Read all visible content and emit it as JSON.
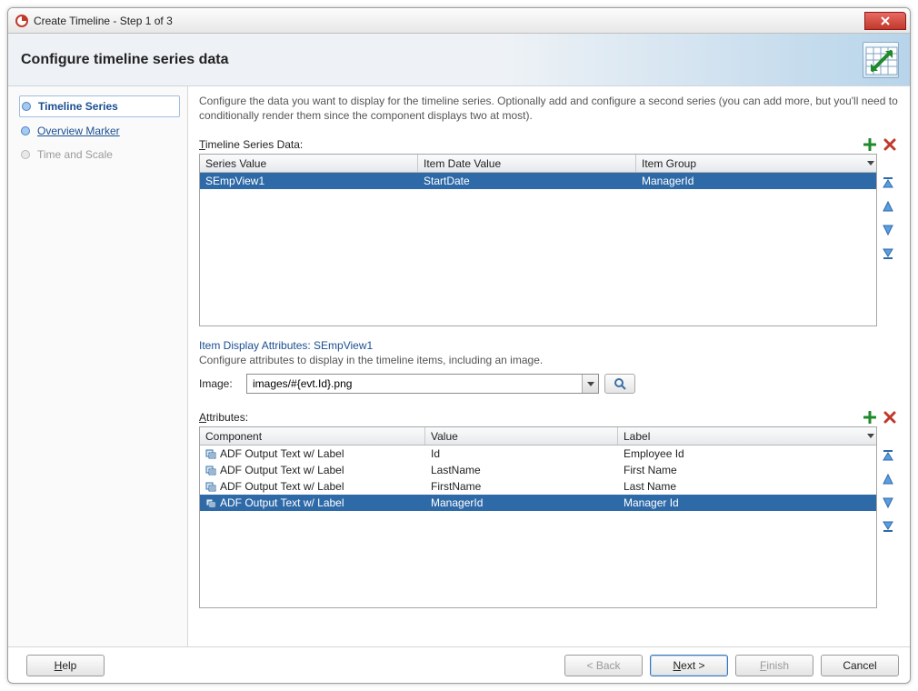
{
  "window": {
    "title": "Create Timeline - Step 1 of 3"
  },
  "header": {
    "title": "Configure timeline series data"
  },
  "description": "Configure the data you want to display for the timeline series. Optionally add and configure a second series (you can add more, but you'll need to conditionally render them since the component displays two at most).",
  "nav": {
    "items": [
      {
        "label": "Timeline Series",
        "state": "active"
      },
      {
        "label": "Overview Marker",
        "state": "link"
      },
      {
        "label": "Time and Scale",
        "state": "disabled"
      }
    ]
  },
  "series": {
    "label_pre": "T",
    "label_rest": "imeline Series Data:",
    "columns": {
      "c1": "Series Value",
      "c2": "Item Date Value",
      "c3": "Item Group"
    },
    "rows": [
      {
        "c1": "SEmpView1",
        "c2": "StartDate",
        "c3": "ManagerId",
        "selected": true
      }
    ]
  },
  "item_display": {
    "title": "Item Display Attributes: SEmpView1",
    "desc": "Configure attributes to display in the timeline items, including an image.",
    "image_label": "Image:",
    "image_value": "images/#{evt.Id}.png"
  },
  "attributes": {
    "label_pre": "A",
    "label_rest": "ttributes:",
    "columns": {
      "c1": "Component",
      "c2": "Value",
      "c3": "Label"
    },
    "rows": [
      {
        "c1": "ADF Output Text w/ Label",
        "c2": "Id",
        "c3": "Employee Id",
        "selected": false
      },
      {
        "c1": "ADF Output Text w/ Label",
        "c2": "LastName",
        "c3": "First Name",
        "selected": false
      },
      {
        "c1": "ADF Output Text w/ Label",
        "c2": "FirstName",
        "c3": "Last Name",
        "selected": false
      },
      {
        "c1": "ADF Output Text w/ Label",
        "c2": "ManagerId",
        "c3": "Manager Id",
        "selected": true
      }
    ]
  },
  "footer": {
    "help": "Help",
    "back": "< Back",
    "next_pre": "N",
    "next_rest": "ext >",
    "finish_pre": "F",
    "finish_rest": "inish",
    "cancel": "Cancel"
  },
  "icons": {
    "add": "add-icon",
    "delete": "delete-icon",
    "top": "move-top-icon",
    "up": "move-up-icon",
    "down": "move-down-icon",
    "bottom": "move-bottom-icon",
    "search": "search-icon"
  }
}
